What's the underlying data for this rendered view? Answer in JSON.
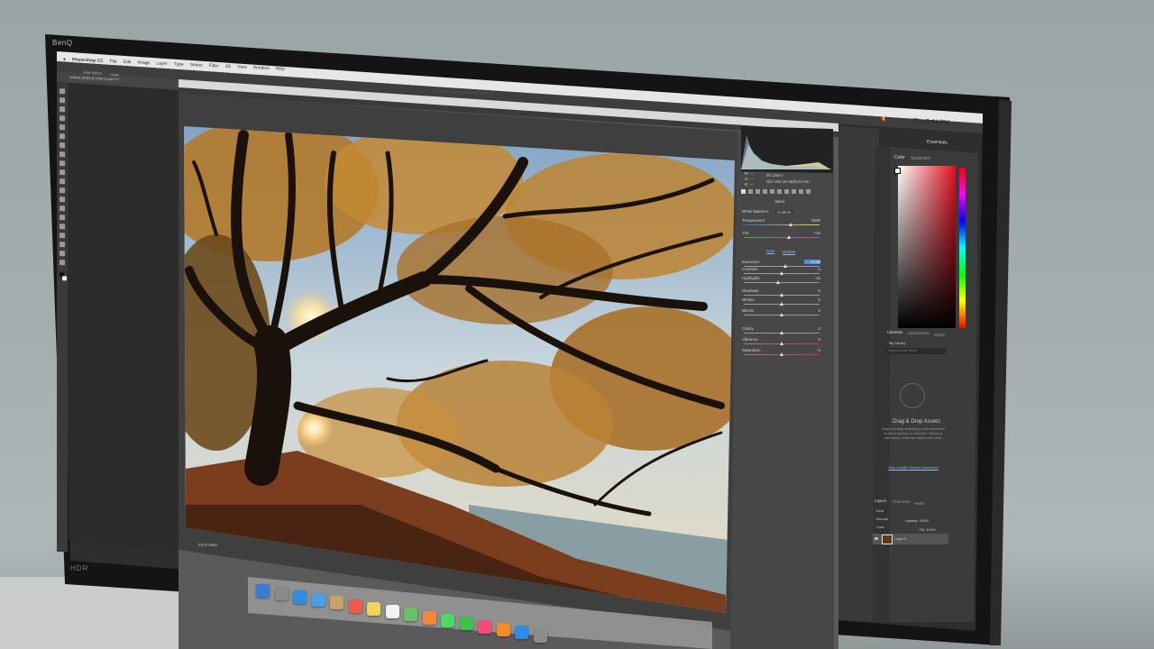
{
  "monitor": {
    "brand_top": "BenQ",
    "brand_bottom": "HDR"
  },
  "menubar": {
    "app_name": "Photoshop CC",
    "items": [
      "File",
      "Edit",
      "Image",
      "Layer",
      "Type",
      "Select",
      "Filter",
      "3D",
      "View",
      "Window",
      "Help"
    ],
    "clock": "Thu 2:44 PM"
  },
  "photoshop": {
    "doc_tab": "Untitled_HDR2 @ 100% (Layer 0, RGB/16*)",
    "options": [
      "Auto-Select",
      "Layer",
      "Show Transform Controls"
    ],
    "workspace": "Essentials"
  },
  "camera_raw": {
    "window_title": "Camera Raw (Untitled_HDR2)",
    "zoom": "Fit in View",
    "histogram_readout": [
      "R: ---",
      "G: ---",
      "B: ---",
      "f/8   1/60 s",
      "ISO 100   16-35@16 mm"
    ],
    "panel_title": "Basic",
    "white_balance_label": "White Balance:",
    "white_balance_value": "Custom",
    "auto_label": "Auto",
    "default_label": "Default",
    "sliders": [
      {
        "label": "Temperature",
        "value": "5500"
      },
      {
        "label": "Tint",
        "value": "+10"
      },
      {
        "label": "Exposure",
        "value": "+0.40"
      },
      {
        "label": "Contrast",
        "value": "0"
      },
      {
        "label": "Highlights",
        "value": "-15"
      },
      {
        "label": "Shadows",
        "value": "0"
      },
      {
        "label": "Whites",
        "value": "0"
      },
      {
        "label": "Blacks",
        "value": "0"
      },
      {
        "label": "Clarity",
        "value": "0"
      },
      {
        "label": "Vibrance",
        "value": "0"
      },
      {
        "label": "Saturation",
        "value": "0"
      }
    ]
  },
  "right_panels": {
    "color_tabs": [
      "Color",
      "Swatches"
    ],
    "lib_tabs": [
      "Libraries",
      "Adjustments",
      "Styles"
    ],
    "library_name": "My Library",
    "search_placeholder": "Search Adobe Stock",
    "dd_title": "Drag & Drop Assets",
    "dd_text": "Drag and drop anything in your document to add it quickly, or click the + below to add colors, character styles and more.",
    "dd_link": "Start a Better Shared Experience",
    "layer_tabs": [
      "Layers",
      "Channels",
      "Paths"
    ],
    "kind": "Kind",
    "blend_mode": "Normal",
    "opacity": "Opacity: 100%",
    "lock": "Lock:",
    "fill": "Fill: 100%",
    "layer_name": "Layer 0"
  },
  "dock": {
    "icons": [
      "finder-icon",
      "launchpad-icon",
      "safari-icon",
      "mail-icon",
      "contacts-icon",
      "calendar-icon",
      "notes-icon",
      "reminders-icon",
      "maps-icon",
      "photos-icon",
      "messages-icon",
      "facetime-icon",
      "itunes-icon",
      "ibooks-icon",
      "appstore-icon",
      "preferences-icon"
    ],
    "colors": [
      "#3a7bd5",
      "#8a8a8a",
      "#2f8ee0",
      "#4aa0e8",
      "#c9a26b",
      "#ef5b4b",
      "#f3d35a",
      "#f2f2f2",
      "#6bbf6b",
      "#f08a3a",
      "#4cd964",
      "#3cc14e",
      "#f64a7a",
      "#f08c2a",
      "#2d8ce8",
      "#8c8c8c"
    ]
  },
  "colors": {
    "ps_dark": "#2f2f2f",
    "ps_panel": "#3c3c3c",
    "cr_panel": "#4a4a4a",
    "accent_blue": "#4a8fe0"
  }
}
